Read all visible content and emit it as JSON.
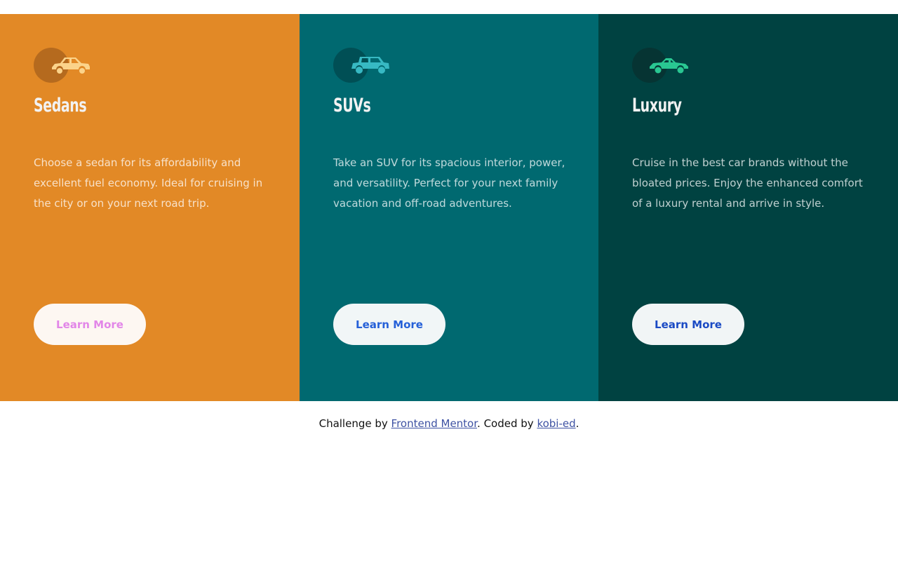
{
  "cards": [
    {
      "title": "Sedans",
      "icon": "sedan-car-icon",
      "description": "Choose a sedan for its affordability and excellent fuel economy. Ideal for cruising in the city or on your next road trip.",
      "button_label": "Learn More",
      "colors": {
        "background": "#e28926",
        "disc": "#b56a1e",
        "icon": "#fbd38a",
        "button_bg": "#fdf7f2",
        "button_text": "#e286e8"
      }
    },
    {
      "title": "SUVs",
      "icon": "suv-car-icon",
      "description": "Take an SUV for its spacious interior, power, and versatility. Perfect for your next family vacation and off-road adventures.",
      "button_label": "Learn More",
      "colors": {
        "background": "#006970",
        "disc": "#004f55",
        "icon": "#37b9c3",
        "button_bg": "#f1f6f7",
        "button_text": "#2560d8"
      }
    },
    {
      "title": "Luxury",
      "icon": "luxury-car-icon",
      "description": "Cruise in the best car brands without the bloated prices. Enjoy the enhanced comfort of a luxury rental and arrive in style.",
      "button_label": "Learn More",
      "colors": {
        "background": "#004241",
        "disc": "#063433",
        "icon": "#29c792",
        "button_bg": "#f1f5f6",
        "button_text": "#1a4ac4"
      }
    }
  ],
  "footer": {
    "prefix": "Challenge by ",
    "link1": "Frontend Mentor",
    "middle": ". Coded by ",
    "link2": "kobi-ed",
    "suffix": "."
  }
}
